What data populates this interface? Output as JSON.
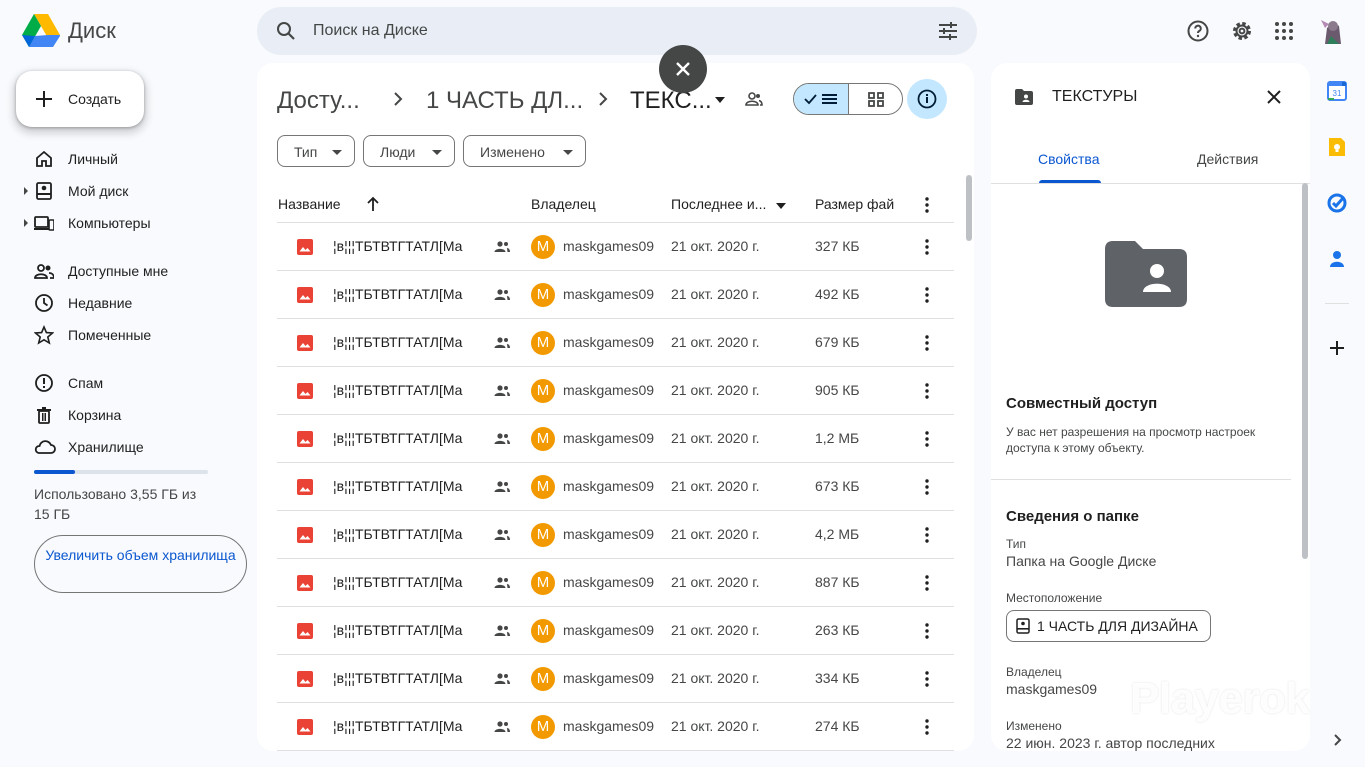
{
  "app": {
    "title": "Диск"
  },
  "search": {
    "placeholder": "Поиск на Диске"
  },
  "sidebar": {
    "create_label": "Создать",
    "items": [
      {
        "label": "Личный",
        "icon": "home-icon"
      },
      {
        "label": "Мой диск",
        "icon": "my-drive-icon"
      },
      {
        "label": "Компьютеры",
        "icon": "computers-icon"
      },
      {
        "label": "Доступные мне",
        "icon": "shared-with-me-icon"
      },
      {
        "label": "Недавние",
        "icon": "recent-icon"
      },
      {
        "label": "Помеченные",
        "icon": "star-icon"
      },
      {
        "label": "Спам",
        "icon": "spam-icon"
      },
      {
        "label": "Корзина",
        "icon": "trash-icon"
      },
      {
        "label": "Хранилище",
        "icon": "cloud-icon"
      }
    ],
    "storage": {
      "used_fraction": 0.237,
      "text": "Использовано 3,55 ГБ из 15 ГБ"
    },
    "upgrade_label": "Увеличить объем хранилища"
  },
  "breadcrumb": {
    "items": [
      "Досту...",
      "1 ЧАСТЬ ДЛ...",
      "ТЕКС..."
    ]
  },
  "filters": [
    "Тип",
    "Люди",
    "Изменено"
  ],
  "table": {
    "headers": {
      "name": "Название",
      "owner": "Владелец",
      "modified": "Последнее и...",
      "size": "Размер фай"
    },
    "rows": [
      {
        "name": "¦в¦¦¦ТБТВТГТАТЛ[Ма",
        "avatar": "M",
        "owner": "maskgames09",
        "date": "21 окт. 2020 г.",
        "size": "327 КБ"
      },
      {
        "name": "¦в¦¦¦ТБТВТГТАТЛ[Ма",
        "avatar": "M",
        "owner": "maskgames09",
        "date": "21 окт. 2020 г.",
        "size": "492 КБ"
      },
      {
        "name": "¦в¦¦¦ТБТВТГТАТЛ[Ма",
        "avatar": "M",
        "owner": "maskgames09",
        "date": "21 окт. 2020 г.",
        "size": "679 КБ"
      },
      {
        "name": "¦в¦¦¦ТБТВТГТАТЛ[Ма",
        "avatar": "M",
        "owner": "maskgames09",
        "date": "21 окт. 2020 г.",
        "size": "905 КБ"
      },
      {
        "name": "¦в¦¦¦ТБТВТГТАТЛ[Ма",
        "avatar": "M",
        "owner": "maskgames09",
        "date": "21 окт. 2020 г.",
        "size": "1,2 МБ"
      },
      {
        "name": "¦в¦¦¦ТБТВТГТАТЛ[Ма",
        "avatar": "M",
        "owner": "maskgames09",
        "date": "21 окт. 2020 г.",
        "size": "673 КБ"
      },
      {
        "name": "¦в¦¦¦ТБТВТГТАТЛ[Ма",
        "avatar": "M",
        "owner": "maskgames09",
        "date": "21 окт. 2020 г.",
        "size": "4,2 МБ"
      },
      {
        "name": "¦в¦¦¦ТБТВТГТАТЛ[Ма",
        "avatar": "M",
        "owner": "maskgames09",
        "date": "21 окт. 2020 г.",
        "size": "887 КБ"
      },
      {
        "name": "¦в¦¦¦ТБТВТГТАТЛ[Ма",
        "avatar": "M",
        "owner": "maskgames09",
        "date": "21 окт. 2020 г.",
        "size": "263 КБ"
      },
      {
        "name": "¦в¦¦¦ТБТВТГТАТЛ[Ма",
        "avatar": "M",
        "owner": "maskgames09",
        "date": "21 окт. 2020 г.",
        "size": "334 КБ"
      },
      {
        "name": "¦в¦¦¦ТБТВТГТАТЛ[Ма",
        "avatar": "M",
        "owner": "maskgames09",
        "date": "21 окт. 2020 г.",
        "size": "274 КБ"
      }
    ]
  },
  "details": {
    "title": "ТЕКСТУРЫ",
    "tabs": {
      "properties": "Свойства",
      "actions": "Действия"
    },
    "sharing_title": "Совместный доступ",
    "sharing_text": "У вас нет разрешения на просмотр настроек доступа к этому объекту.",
    "folder_info_title": "Сведения о папке",
    "type_label": "Тип",
    "type_value": "Папка на Google Диске",
    "location_label": "Местоположение",
    "location_value": "1 ЧАСТЬ ДЛЯ ДИЗАЙНА",
    "owner_label": "Владелец",
    "owner_value": "maskgames09",
    "modified_label": "Изменено",
    "modified_value": "22 июн. 2023 г. автор последних"
  },
  "watermark": "Playerok",
  "colors": {
    "accent": "#0b57d0",
    "selected": "#c2e7ff",
    "owner_avatar": "#f29900",
    "image_file": "#ea4335"
  }
}
